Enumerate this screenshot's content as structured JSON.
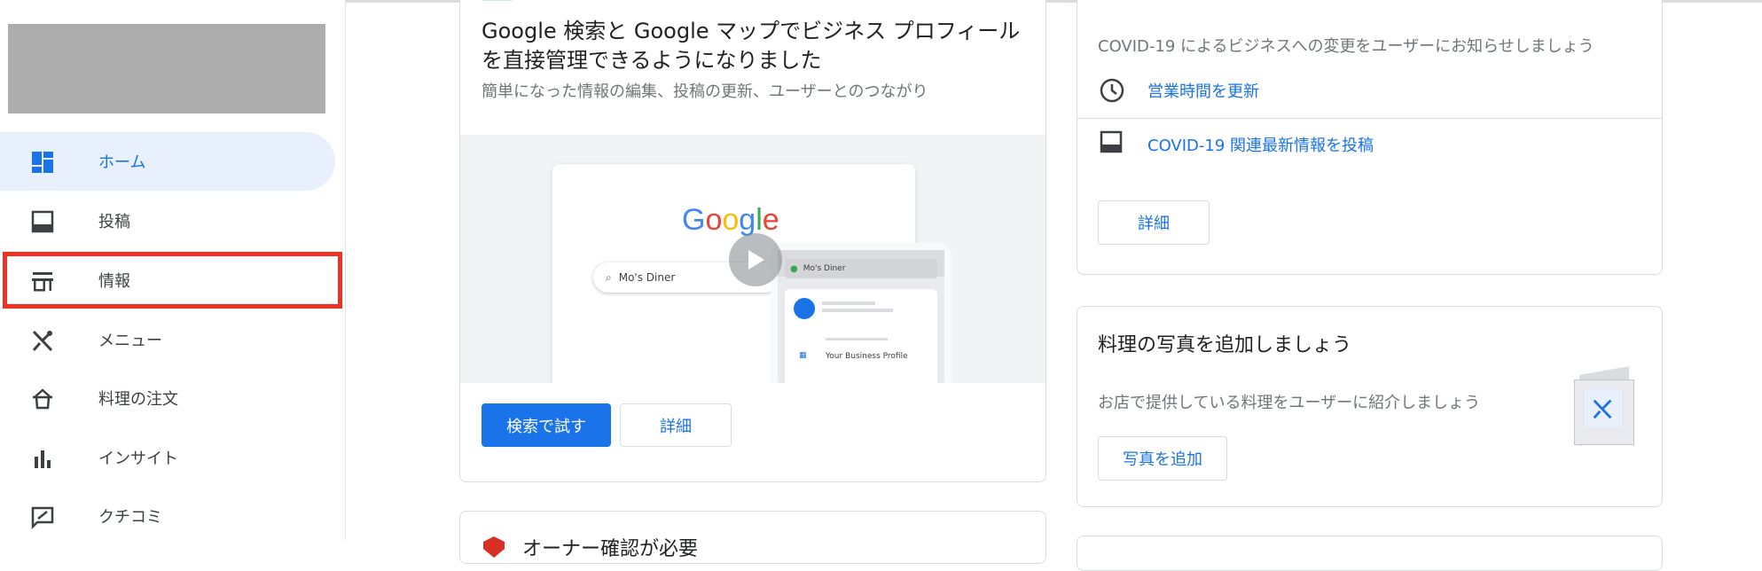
{
  "sidebar": {
    "items": [
      {
        "label": "ホーム",
        "icon": "dashboard-icon"
      },
      {
        "label": "投稿",
        "icon": "post-icon"
      },
      {
        "label": "情報",
        "icon": "storefront-icon"
      },
      {
        "label": "メニュー",
        "icon": "utensils-icon"
      },
      {
        "label": "料理の注文",
        "icon": "food-order-icon"
      },
      {
        "label": "インサイト",
        "icon": "insights-icon"
      },
      {
        "label": "クチコミ",
        "icon": "reviews-icon"
      }
    ],
    "active_index": 0,
    "highlighted_index": 2
  },
  "promo_card": {
    "title": "Google 検索と Google マップでビジネス プロフィールを直接管理できるようになりました",
    "subtitle": "簡単になった情報の編集、投稿の更新、ユーザーとのつながり",
    "illustration": {
      "brand": "Google",
      "search_text": "Mo's Diner",
      "map_search_text": "Mo's Diner",
      "profile_text": "Your Business Profile"
    },
    "primary_button": "検索で試す",
    "secondary_button": "詳細"
  },
  "covid_card": {
    "description": "COVID-19 によるビジネスへの変更をユーザーにお知らせしましょう",
    "action_1": "営業時間を更新",
    "action_2": "COVID-19 関連最新情報を投稿",
    "details_button": "詳細"
  },
  "food_photo_card": {
    "title": "料理の写真を追加しましょう",
    "description": "お店で提供している料理をユーザーに紹介しましょう",
    "button": "写真を追加"
  },
  "bottom_card": {
    "title": "オーナー確認が必要"
  },
  "colors": {
    "accent": "#1a73e8",
    "highlight": "#ee3124",
    "active_bg": "#e8f0fe"
  }
}
